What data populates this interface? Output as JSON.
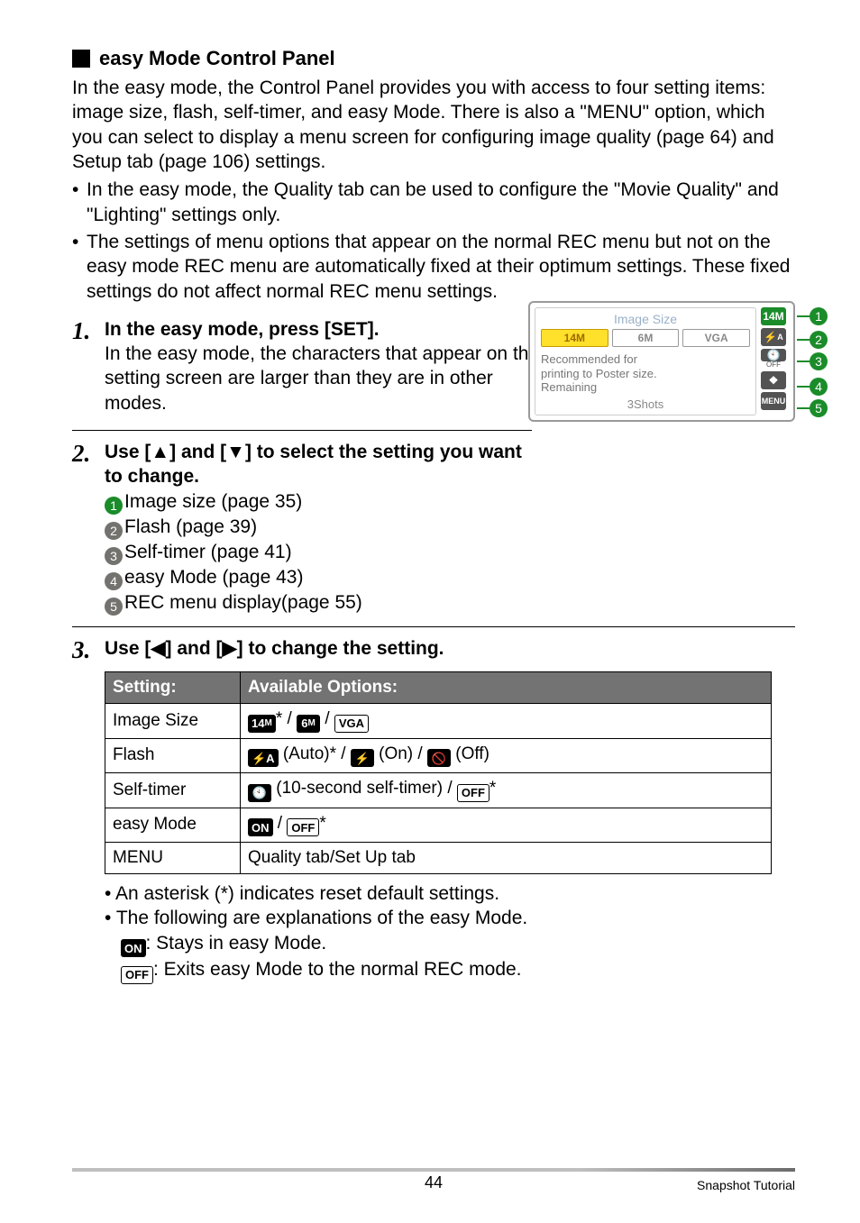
{
  "section_title": "easy Mode Control Panel",
  "intro_p": "In the easy mode, the Control Panel provides you with access to four setting items: image size, flash, self-timer, and easy Mode. There is also a \"MENU\" option, which you can select to display a menu screen for configuring image quality (page 64) and Setup tab (page 106) settings.",
  "intro_bullets": [
    "In the easy mode, the Quality tab can be used to configure the \"Movie Quality\" and \"Lighting\" settings only.",
    "The settings of menu options that appear on the normal REC menu but not on the easy mode REC menu are automatically fixed at their optimum settings. These fixed settings do not affect normal REC menu settings."
  ],
  "step1": {
    "num": "1.",
    "title": "In the easy mode, press [SET].",
    "body": "In the easy mode, the characters that appear on the setting screen are larger than they are in other modes."
  },
  "step2": {
    "num": "2.",
    "title_a": "Use [",
    "title_b": "] and [",
    "title_c": "] to select the setting you want to change.",
    "items": [
      "Image size (page 35)",
      "Flash (page 39)",
      "Self-timer (page 41)",
      "easy Mode (page 43)",
      "REC menu display(page 55)"
    ]
  },
  "step3": {
    "num": "3.",
    "title_a": "Use [",
    "title_b": "] and [",
    "title_c": "] to change the setting."
  },
  "table": {
    "h1": "Setting:",
    "h2": "Available Options:",
    "rows": [
      {
        "label": "Image Size"
      },
      {
        "label": "Flash"
      },
      {
        "label": "Self-timer"
      },
      {
        "label": "easy Mode"
      },
      {
        "label": "MENU",
        "plain": "Quality tab/Set Up tab"
      }
    ],
    "flash": {
      "auto": "(Auto)",
      "on": "(On)",
      "off": "(Off)"
    },
    "selftimer": "(10-second self-timer)",
    "img14": "14",
    "img6": "6",
    "imgvga": "VGA",
    "on": "ON",
    "off": "OFF",
    "menu": "MENU"
  },
  "notes": {
    "n1": "An asterisk (*) indicates reset default settings.",
    "n2": "The following are explanations of the easy Mode.",
    "on_desc": ": Stays in easy Mode.",
    "off_desc": ": Exits easy Mode to the normal REC mode."
  },
  "cam": {
    "title": "Image Size",
    "tabs": [
      "14M",
      "6M",
      "VGA"
    ],
    "desc1": "Recommended for",
    "desc2": "printing to Poster size.",
    "desc3": "Remaining",
    "shots": "3Shots",
    "right_icons": [
      "14M",
      "⚡A",
      "⏱",
      "❖",
      "MENU"
    ],
    "off_label": "OFF"
  },
  "page_num": "44",
  "footer_right": "Snapshot Tutorial",
  "chart_data": null
}
